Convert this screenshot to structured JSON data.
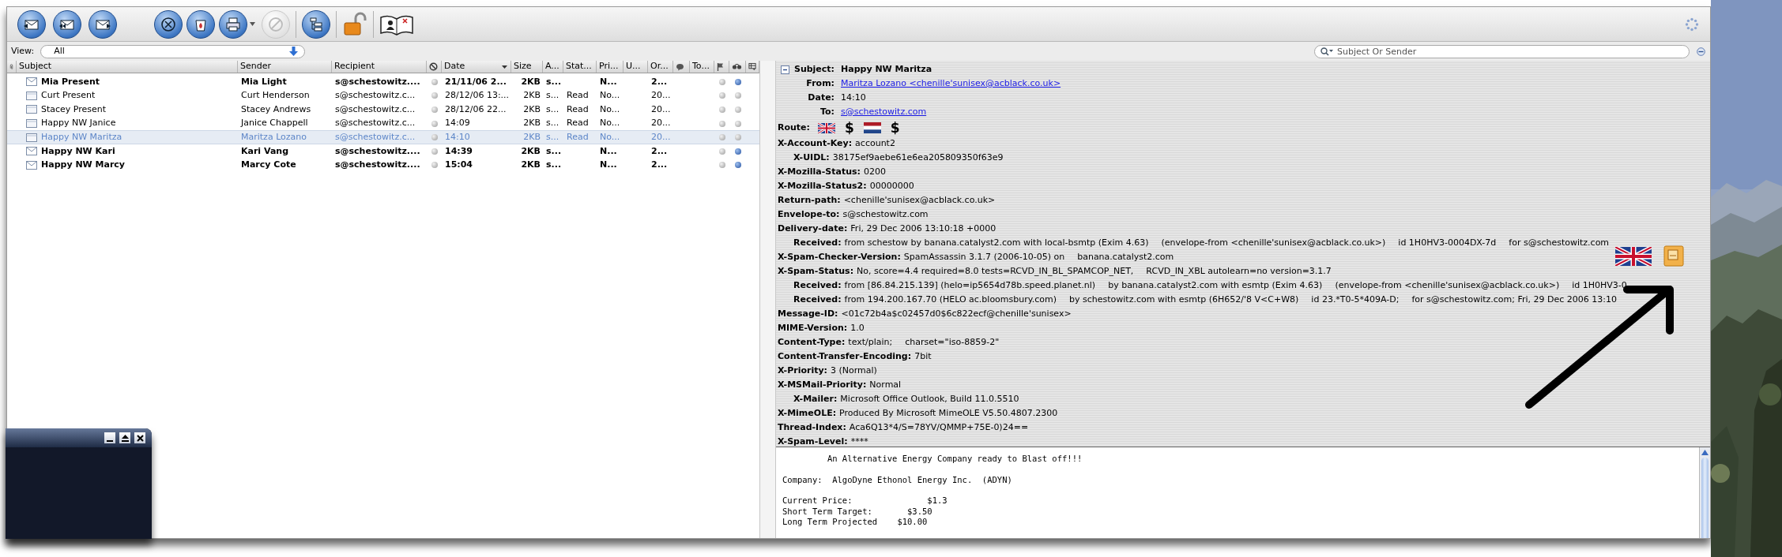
{
  "view": {
    "label": "View:",
    "value": "All"
  },
  "search": {
    "placeholder": "Subject Or Sender"
  },
  "columns": [
    {
      "kind": "attachment"
    },
    {
      "kind": "text",
      "label": "Subject",
      "sorted": false
    },
    {
      "kind": "text",
      "label": "Sender",
      "sorted": false
    },
    {
      "kind": "text",
      "label": "Recipient",
      "sorted": false
    },
    {
      "kind": "junk"
    },
    {
      "kind": "text",
      "label": "Date",
      "sorted": true
    },
    {
      "kind": "text",
      "label": "Size",
      "sorted": false
    },
    {
      "kind": "text",
      "label": "A...",
      "sorted": false
    },
    {
      "kind": "text",
      "label": "Stat...",
      "sorted": false
    },
    {
      "kind": "text",
      "label": "Pri...",
      "sorted": false
    },
    {
      "kind": "text",
      "label": "U...",
      "sorted": false
    },
    {
      "kind": "text",
      "label": "Or...",
      "sorted": false
    },
    {
      "kind": "comment"
    },
    {
      "kind": "text",
      "label": "To...",
      "sorted": false
    },
    {
      "kind": "flag"
    },
    {
      "kind": "read"
    },
    {
      "kind": "picker"
    }
  ],
  "messages": [
    {
      "subject": "Mia Present",
      "sender": "Mia Light",
      "recipient": "s@schestowitz....",
      "date": "21/11/06 2...",
      "size": "2KB",
      "account": "s...",
      "priority": "N...",
      "order": "2...",
      "unread": true,
      "selected": false
    },
    {
      "subject": "Curt Present",
      "sender": "Curt Henderson",
      "recipient": "s@schestowitz.c...",
      "date": "28/12/06 13:...",
      "size": "2KB",
      "account": "s...",
      "status": "Read",
      "priority": "No...",
      "order": "20...",
      "unread": false,
      "selected": false
    },
    {
      "subject": "Stacey Present",
      "sender": "Stacey Andrews",
      "recipient": "s@schestowitz.c...",
      "date": "28/12/06 22...",
      "size": "2KB",
      "account": "s...",
      "status": "Read",
      "priority": "No...",
      "order": "20...",
      "unread": false,
      "selected": false
    },
    {
      "subject": "Happy NW Janice",
      "sender": "Janice Chappell",
      "recipient": "s@schestowitz.c...",
      "date": "14:09",
      "size": "2KB",
      "account": "s...",
      "status": "Read",
      "priority": "No...",
      "order": "20...",
      "unread": false,
      "selected": false
    },
    {
      "subject": "Happy NW Maritza",
      "sender": "Maritza Lozano",
      "recipient": "s@schestowitz.c...",
      "date": "14:10",
      "size": "2KB",
      "account": "s...",
      "status": "Read",
      "priority": "No...",
      "order": "20...",
      "unread": false,
      "selected": true
    },
    {
      "subject": "Happy NW Kari",
      "sender": "Kari Vang",
      "recipient": "s@schestowitz....",
      "date": "14:39",
      "size": "2KB",
      "account": "s...",
      "priority": "N...",
      "order": "2...",
      "unread": true,
      "selected": false
    },
    {
      "subject": "Happy NW Marcy",
      "sender": "Marcy Cote",
      "recipient": "s@schestowitz....",
      "date": "15:04",
      "size": "2KB",
      "account": "s...",
      "priority": "N...",
      "order": "2...",
      "unread": true,
      "selected": false
    }
  ],
  "headers": [
    {
      "kind": "subject",
      "label": "Subject:",
      "value": "Happy NW Maritza"
    },
    {
      "kind": "link",
      "label": "From:",
      "value": "Maritza Lozano <chenille'sunisex@acblack.co.uk>"
    },
    {
      "kind": "top",
      "label": "Date:",
      "value": "14:10"
    },
    {
      "kind": "link",
      "label": "To:",
      "value": "s@schestowitz.com"
    },
    {
      "kind": "route",
      "label": "Route:",
      "route": [
        {
          "kind": "uk-flag"
        },
        {
          "kind": "dollar",
          "text": "$"
        },
        {
          "kind": "nl-flag"
        },
        {
          "kind": "dollar",
          "text": "$"
        }
      ]
    },
    {
      "kind": "plain",
      "label": "X-Account-Key:",
      "value": "account2"
    },
    {
      "kind": "indented",
      "label": "X-UIDL:",
      "value": "38175ef9aebe61e6ea205809350f63e9"
    },
    {
      "kind": "plain",
      "label": "X-Mozilla-Status:",
      "value": "0200"
    },
    {
      "kind": "plain",
      "label": "X-Mozilla-Status2:",
      "value": "00000000"
    },
    {
      "kind": "plain",
      "label": "Return-path:",
      "value": "<chenille'sunisex@acblack.co.uk>"
    },
    {
      "kind": "plain",
      "label": "Envelope-to:",
      "value": "s@schestowitz.com"
    },
    {
      "kind": "plain",
      "label": "Delivery-date:",
      "value": "Fri, 29 Dec 2006 13:10:18 +0000"
    },
    {
      "kind": "indented",
      "label": "Received:",
      "parts": [
        "from schestow by banana.catalyst2.com with local-bsmtp (Exim 4.63)",
        "(envelope-from <chenille'sunisex@acblack.co.uk>)",
        "id 1H0HV3-0004DX-7d",
        "for s@schestowitz.com"
      ]
    },
    {
      "kind": "plain",
      "label": "X-Spam-Checker-Version:",
      "parts": [
        "SpamAssassin 3.1.7 (2006-10-05) on",
        "banana.catalyst2.com"
      ]
    },
    {
      "kind": "plain",
      "label": "X-Spam-Status:",
      "parts": [
        "No, score=4.4 required=8.0 tests=RCVD_IN_BL_SPAMCOP_NET,",
        "RCVD_IN_XBL autolearn=no version=3.1.7"
      ]
    },
    {
      "kind": "indented",
      "label": "Received:",
      "parts": [
        "from [86.84.215.139] (helo=ip5654d78b.speed.planet.nl)",
        "by banana.catalyst2.com with esmtp (Exim 4.63)",
        "(envelope-from <chenille'sunisex@acblack.co.uk>)",
        "id 1H0HV3-0"
      ]
    },
    {
      "kind": "indented",
      "label": "Received:",
      "parts": [
        "from 194.200.167.70 (HELO ac.bloomsbury.com)",
        "by schestowitz.com with esmtp (6H652/'8 V<C+W8)",
        "id 23.*T0-5*409A-D;",
        "for s@schestowitz.com; Fri, 29 Dec 2006 13:10"
      ]
    },
    {
      "kind": "plain",
      "label": "Message-ID:",
      "value": "<01c72b4a$c02457d0$6c822ecf@chenille'sunisex>"
    },
    {
      "kind": "plain",
      "label": "MIME-Version:",
      "value": "1.0"
    },
    {
      "kind": "plain",
      "label": "Content-Type:",
      "parts": [
        "text/plain;",
        "charset=\"iso-8859-2\""
      ]
    },
    {
      "kind": "plain",
      "label": "Content-Transfer-Encoding:",
      "value": "7bit"
    },
    {
      "kind": "plain",
      "label": "X-Priority:",
      "value": "3 (Normal)"
    },
    {
      "kind": "plain",
      "label": "X-MSMail-Priority:",
      "value": "Normal"
    },
    {
      "kind": "indented",
      "label": "X-Mailer:",
      "value": "Microsoft Office Outlook, Build 11.0.5510"
    },
    {
      "kind": "plain",
      "label": "X-MimeOLE:",
      "value": "Produced By Microsoft MimeOLE V5.50.4807.2300"
    },
    {
      "kind": "plain",
      "label": "Thread-Index:",
      "value": "Aca6Q13*4/S=78YV/QMMP+75E-0)24=="
    },
    {
      "kind": "plain",
      "label": "X-Spam-Level:",
      "value": "****"
    }
  ],
  "body": [
    [
      "         An Alternative Energy Company ready to Blast off!!!"
    ],
    [
      "Company:  AlgoDyne Ethonol Energy Inc.  (ADYN)"
    ],
    [
      "Current Price:               $1.3",
      "Short Term Target:       $3.50",
      "Long Term Projected    $10.00"
    ]
  ]
}
